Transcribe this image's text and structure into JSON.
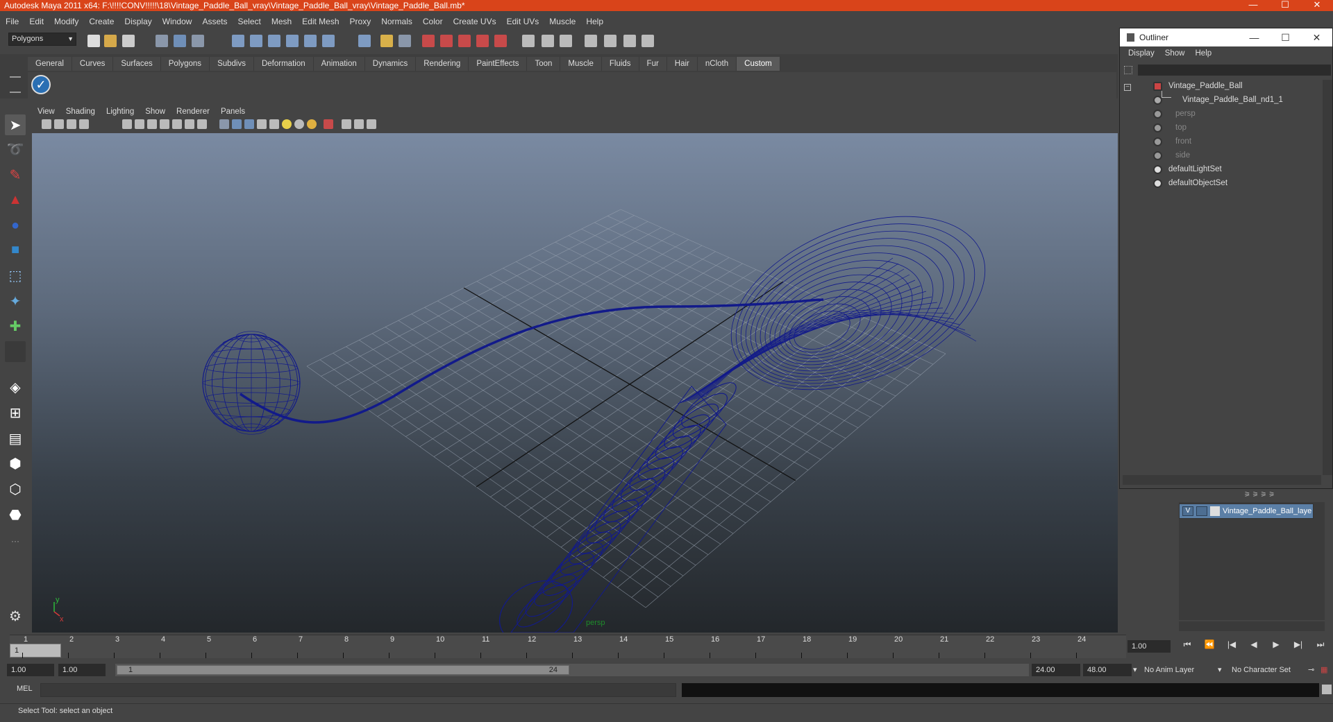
{
  "window": {
    "title": "Autodesk Maya 2011 x64: F:\\!!!!CONV!!!!!\\18\\Vintage_Paddle_Ball_vray\\Vintage_Paddle_Ball_vray\\Vintage_Paddle_Ball.mb*",
    "minimize": "—",
    "maximize": "☐",
    "close": "✕"
  },
  "menubar": [
    "File",
    "Edit",
    "Modify",
    "Create",
    "Display",
    "Window",
    "Assets",
    "Select",
    "Mesh",
    "Edit Mesh",
    "Proxy",
    "Normals",
    "Color",
    "Create UVs",
    "Edit UVs",
    "Muscle",
    "Help"
  ],
  "statusline": {
    "mode": "Polygons"
  },
  "shelf": {
    "tabs": [
      "General",
      "Curves",
      "Surfaces",
      "Polygons",
      "Subdivs",
      "Deformation",
      "Animation",
      "Dynamics",
      "Rendering",
      "PaintEffects",
      "Toon",
      "Muscle",
      "Fluids",
      "Fur",
      "Hair",
      "nCloth",
      "Custom"
    ],
    "active_tab": "Custom"
  },
  "viewport": {
    "menu": [
      "View",
      "Shading",
      "Lighting",
      "Show",
      "Renderer",
      "Panels"
    ],
    "camera_label": "persp",
    "axis_x": "x",
    "axis_y": "y"
  },
  "outliner": {
    "title": "Outliner",
    "menu": [
      "Display",
      "Show",
      "Help"
    ],
    "items": [
      {
        "label": "Vintage_Paddle_Ball",
        "dim": false
      },
      {
        "label": "Vintage_Paddle_Ball_nd1_1",
        "dim": false
      },
      {
        "label": "persp",
        "dim": true
      },
      {
        "label": "top",
        "dim": true
      },
      {
        "label": "front",
        "dim": true
      },
      {
        "label": "side",
        "dim": true
      },
      {
        "label": "defaultLightSet",
        "dim": false
      },
      {
        "label": "defaultObjectSet",
        "dim": false
      }
    ]
  },
  "layers": {
    "visible_flag": "V",
    "layer_name": "Vintage_Paddle_Ball_laye"
  },
  "timeline": {
    "ticks": [
      "1",
      "2",
      "3",
      "4",
      "5",
      "6",
      "7",
      "8",
      "9",
      "10",
      "11",
      "12",
      "13",
      "14",
      "15",
      "16",
      "17",
      "18",
      "19",
      "20",
      "21",
      "22",
      "23",
      "24"
    ],
    "current_frame_marker": "1",
    "current_frame": "1.00"
  },
  "playback": [
    "⏮",
    "⏪",
    "|◀",
    "◀",
    "▶",
    "▶|",
    "⏭"
  ],
  "range": {
    "start_time": "1.00",
    "playback_start": "1.00",
    "handle_start": "1",
    "handle_end": "24",
    "playback_end": "24.00",
    "end_time": "48.00",
    "anim_layer": "No Anim Layer",
    "character_set": "No Character Set"
  },
  "command": {
    "label": "MEL"
  },
  "help_line": "Select Tool: select an object"
}
